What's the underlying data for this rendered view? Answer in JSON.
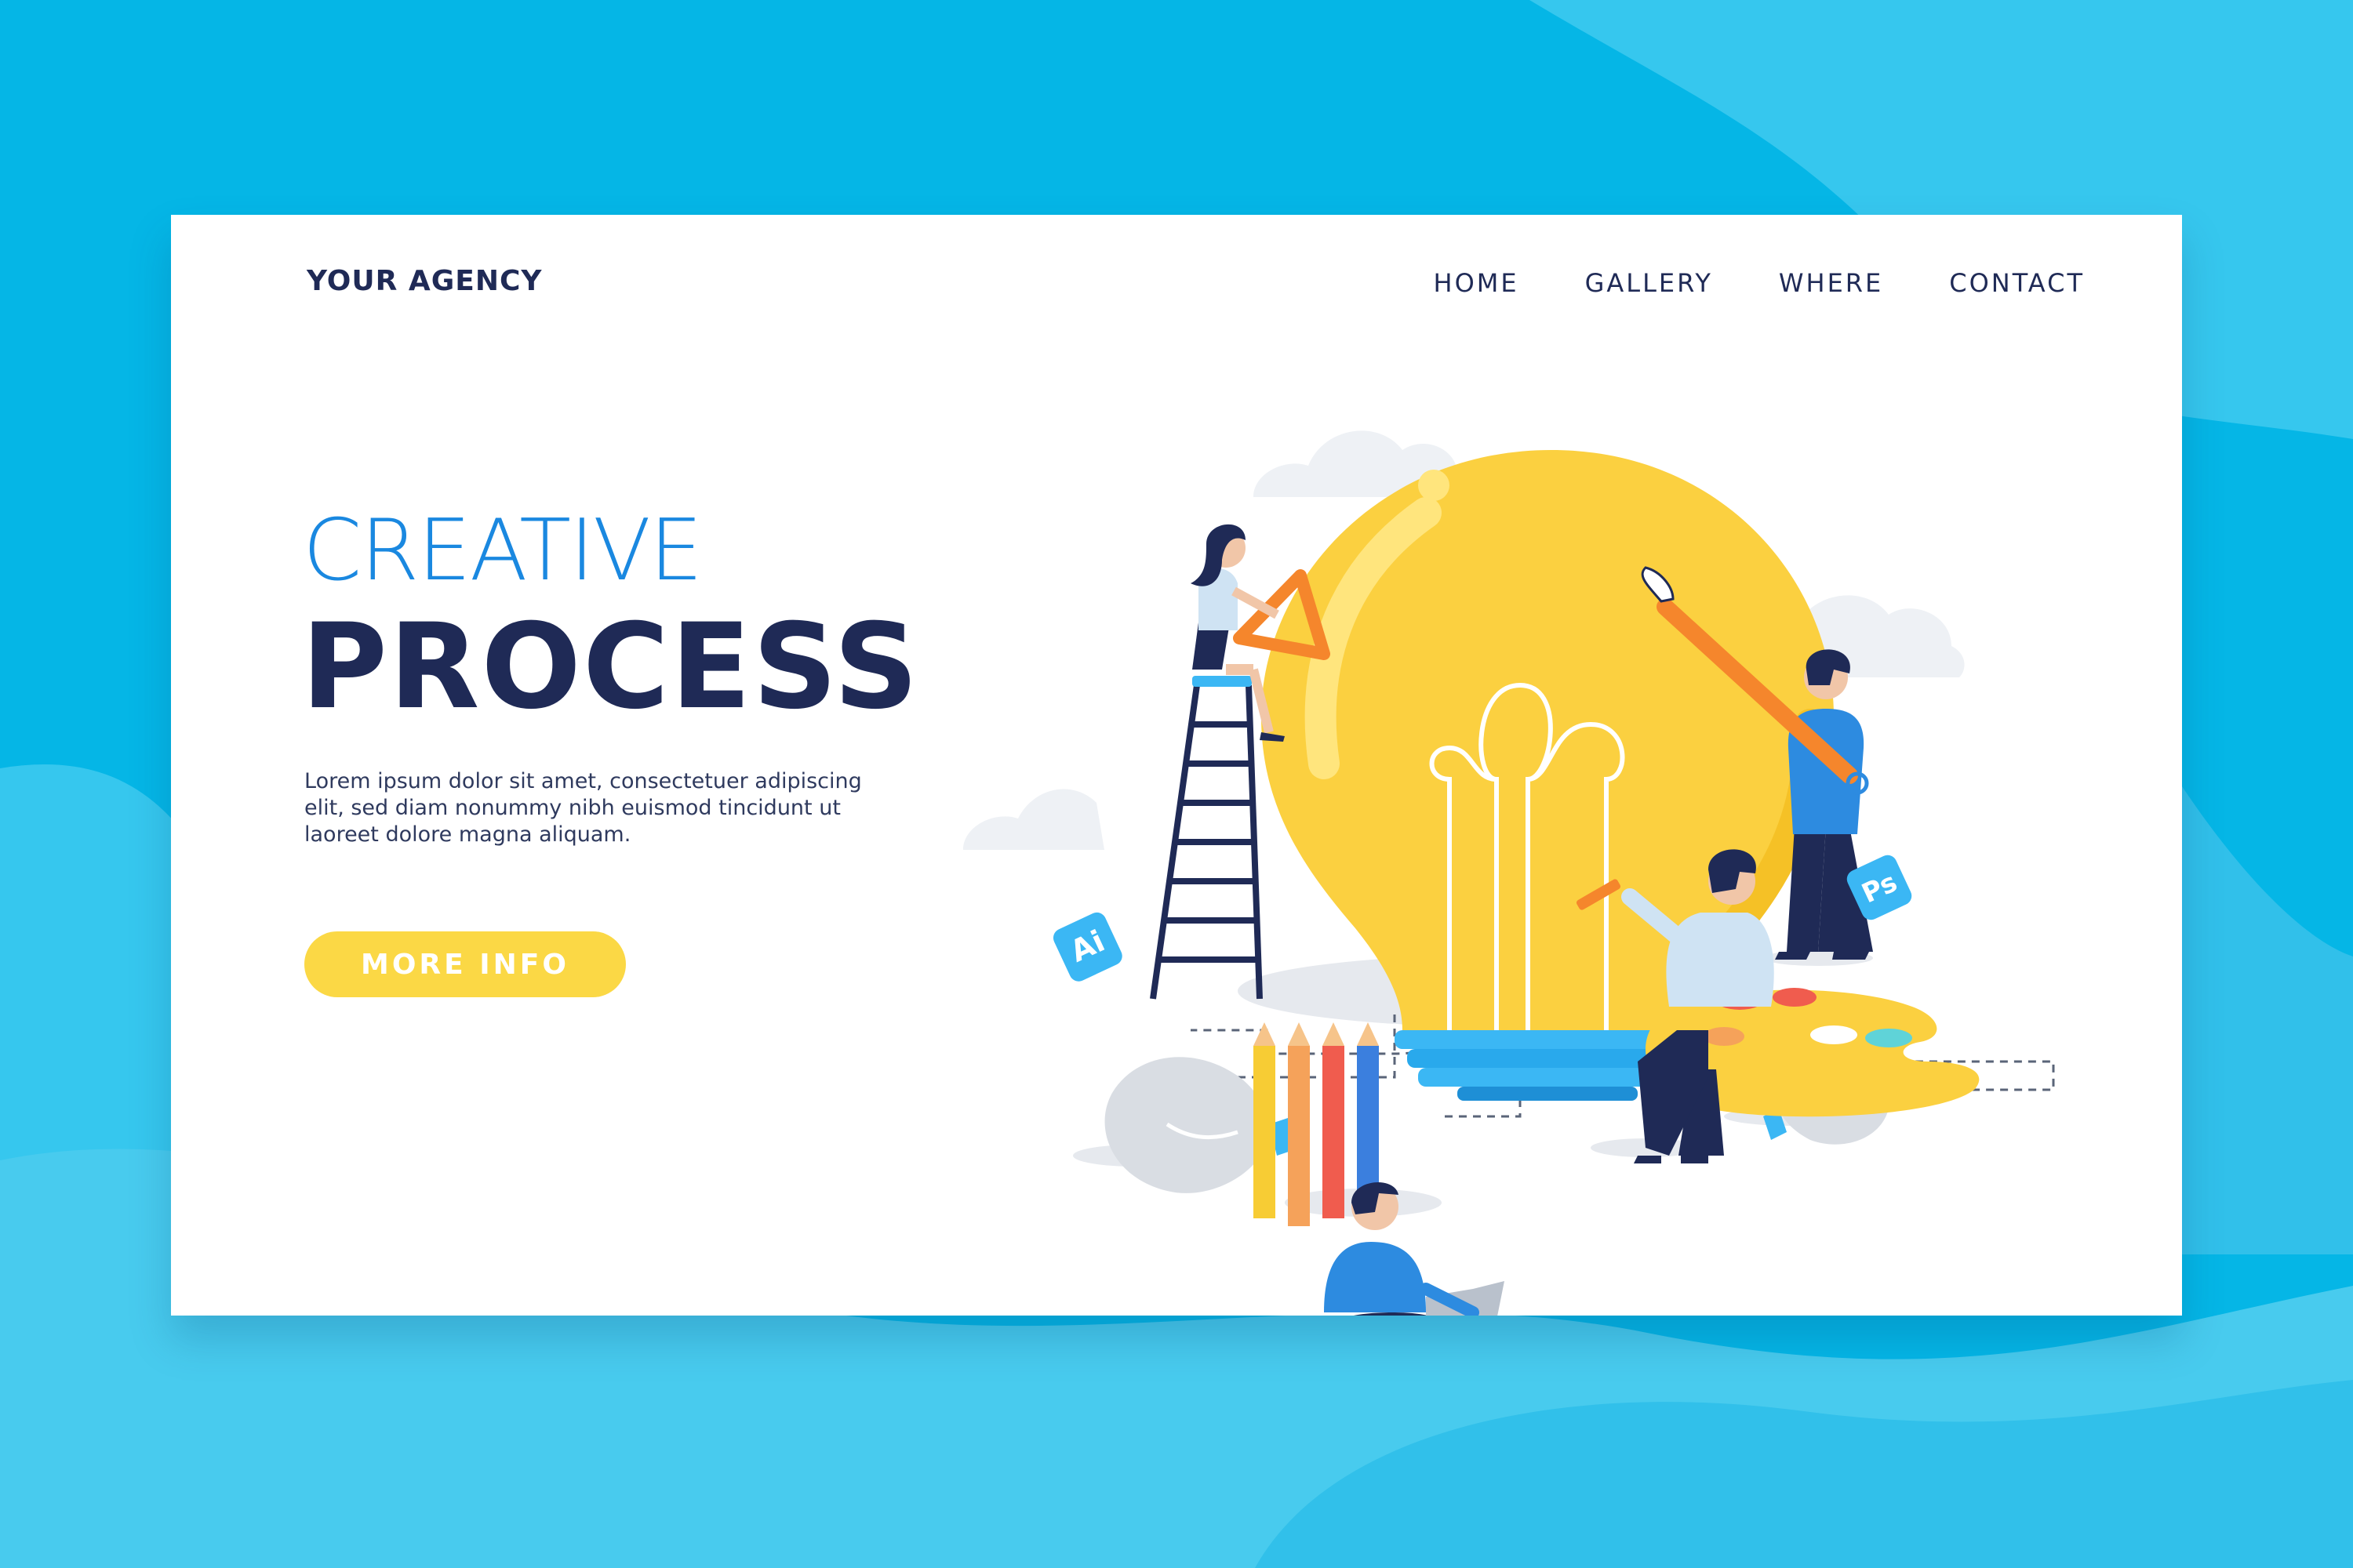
{
  "header": {
    "brand": "YOUR AGENCY",
    "nav": [
      "HOME",
      "GALLERY",
      "WHERE",
      "CONTACT"
    ]
  },
  "hero": {
    "title_line1": "CREATIVE",
    "title_line2": "PROCESS",
    "description": "Lorem ipsum dolor sit amet, consectetuer adipiscing elit, sed diam nonummy nibh euismod tincidunt ut laoreet dolore magna aliquam.",
    "cta_label": "MORE INFO"
  },
  "illustration": {
    "ai_badge": "Ai",
    "ps_badge": "Ps"
  },
  "colors": {
    "background": "#05b6e6",
    "accent_blue": "#1a88e0",
    "navy": "#1f2a56",
    "yellow": "#fbd845"
  }
}
